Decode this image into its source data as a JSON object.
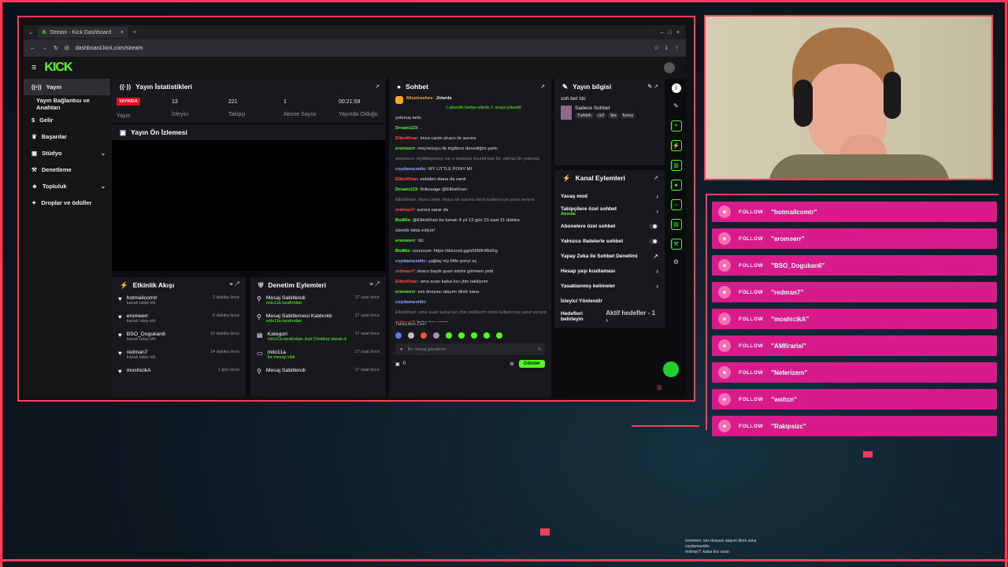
{
  "browser": {
    "tab_title": "Stream - Kick Dashboard",
    "url": "dashboard.kick.com/stream"
  },
  "logo": "KICK",
  "sidebar": {
    "items": [
      {
        "label": "Yayın",
        "icon": "broadcast-icon"
      },
      {
        "label": "Yayın Bağlantısı ve Anahtarı",
        "icon": ""
      },
      {
        "label": "Gelir",
        "icon": "revenue-icon"
      },
      {
        "label": "Başarılar",
        "icon": "trophy-icon"
      },
      {
        "label": "Stüdyo",
        "icon": "studio-icon"
      },
      {
        "label": "Denetleme",
        "icon": "moderation-icon"
      },
      {
        "label": "Topluluk",
        "icon": "community-icon"
      },
      {
        "label": "Droplar ve ödüller",
        "icon": "gift-icon"
      }
    ]
  },
  "stats": {
    "title": "Yayın İstatistikleri",
    "live_badge": "YAYINDA",
    "live_label": "Yayın",
    "viewers_value": "13",
    "viewers_label": "İzleyici",
    "followers_value": "221",
    "followers_label": "Takipçi",
    "subs_value": "1",
    "subs_label": "Abone Sayısı",
    "duration_value": "00:21:59",
    "duration_label": "Yayında Olduğu"
  },
  "preview": {
    "title": "Yayın Ön İzlemesi"
  },
  "activity": {
    "title": "Etkinlik Akışı",
    "items": [
      {
        "name": "hotmailcomtr",
        "sub": "kanalı takip etti",
        "time": "3 dakika önce"
      },
      {
        "name": "eromeerr",
        "sub": "kanalı takip etti",
        "time": "6 dakika önce"
      },
      {
        "name": "BSO_Dogukan6",
        "sub": "kanalı takip etti",
        "time": "10 dakika önce"
      },
      {
        "name": "redman7",
        "sub": "kanalı takip etti",
        "time": "14 dakika önce"
      },
      {
        "name": "moshicikA",
        "sub": "",
        "time": "1 gün önce"
      }
    ]
  },
  "moderation": {
    "title": "Denetim Eylemleri",
    "items": [
      {
        "name": "Mesaj Sabitlendi",
        "sub": "milo11a tarafından",
        "time": "17 saat önce"
      },
      {
        "name": "Mesaj Sabitlemesi Kaldırıldı",
        "sub": "milo11a tarafından",
        "time": "17 saat önce"
      },
      {
        "name": "Kategori",
        "sub": "milo11a tarafından Just Chatting olarak değiştirildi",
        "time": "17 saat önce"
      },
      {
        "name": "milo11a",
        "sub": "bir mesajı sildi",
        "time": "17 saat önce"
      },
      {
        "name": "Mesaj Sabitlendi",
        "sub": "",
        "time": "17 saat önce"
      }
    ]
  },
  "chat": {
    "title": "Sohbet",
    "pinned_user": "Misstrashes",
    "pinned_user2": "Jidanla",
    "pinned_text": "1 abonelik hediye ederek 3. sıraya yükseldi",
    "lines": [
      {
        "user": "",
        "text": "yokmuş tarkı",
        "color": "#ddd"
      },
      {
        "user": "Droam123",
        "text": ": .",
        "color": "#53fc18"
      },
      {
        "user": "ElbisKhan",
        "text": ": imza carim shaco ile aurora",
        "color": "#ff4d4d"
      },
      {
        "user": "eromeerr",
        "text": ": meyvesuyu ile ingilizce denediğim şarkı",
        "color": "#53fc18"
      },
      {
        "user": "",
        "text": "eromeerr: mylittleponey var o messira moziol bak bir varmış bir yokmuş",
        "color": "#888"
      },
      {
        "user": "coydamusidic",
        "text": ": MY LITTLE PONY MI",
        "color": "#8fa7ff"
      },
      {
        "user": "ElbisKhan",
        "text": ": eskiden diana da vardı",
        "color": "#ff4d4d"
      },
      {
        "user": "Droam123",
        "text": ": !followage @ElbisKhan",
        "color": "#53fc18"
      },
      {
        "user": "",
        "text": "ElbisKhan: imza carim shaco ile aurora isimli kullanıcıya yanıt veriyor",
        "color": "#888"
      },
      {
        "user": "redman7",
        "text": ": aurora sarar da",
        "color": "#ff4d4d"
      },
      {
        "user": "BotRix",
        "text": ": @ElbisKhan bu kanalı 4 yıl 13 gün 23 saat 31 dakika",
        "color": "#53fc18"
      },
      {
        "user": "",
        "text": "süredir takip ediyor!",
        "color": "#ddd"
      },
      {
        "user": "eromeerr",
        "text": ": !dc",
        "color": "#53fc18"
      },
      {
        "user": "BotRix",
        "text": ": sunucum: https://discord.gg/s56MK4BdXg",
        "color": "#53fc18"
      },
      {
        "user": "coydamusidic",
        "text": ": çağtay my little ponyi aç",
        "color": "#8fa7ff"
      },
      {
        "user": "redman7",
        "text": ": shaco baydı şuan ismini görmem yetti",
        "color": "#ff4d4d"
      },
      {
        "user": "ElbisKhan",
        "text": ": ama suan kalsa kıcı jhin takiliyom",
        "color": "#ff4d4d"
      },
      {
        "user": "eromeerr",
        "text": ": ses dosyası atayım direk sana",
        "color": "#53fc18"
      },
      {
        "user": "coydamusidic",
        "text": ": ",
        "color": "#8fa7ff"
      },
      {
        "user": "",
        "text": "ElbisKhan: ama suan kalsa kıcı jhin takiliyom isimli kullanıcıya yanıt veriyor",
        "color": "#888"
      },
      {
        "user": "redman7",
        "text": ": kalsa kıcı sarar",
        "color": "#ff4d4d"
      }
    ],
    "followers_only": "Takipçilere Özel",
    "placeholder": "Bir mesaj gönderin",
    "count": "0",
    "send_label": "Gönder"
  },
  "stream_info": {
    "title": "Yayın bilgisi",
    "stream_title": "soh bet !dc",
    "category": "Sadece Sohbet",
    "tags": [
      "Turkish",
      "cs2",
      "fps",
      "funny"
    ]
  },
  "channel_actions": {
    "title": "Kanal Eylemleri",
    "rows": [
      {
        "label": "Yavaş mod",
        "sub": "",
        "right": "›"
      },
      {
        "label": "Takipçilere özel sohbet",
        "sub": "Anında",
        "right": "›"
      },
      {
        "label": "Abonelere özel sohbet",
        "sub": "",
        "right": "toggle"
      },
      {
        "label": "Yalnızca ifadelerle sohbet",
        "sub": "",
        "right": "toggle"
      },
      {
        "label": "Yapay Zeka ile Sohbet Denetimi",
        "sub": "",
        "right": "↗"
      },
      {
        "label": "Hesap yaşı kısıtlaması",
        "sub": "",
        "right": "›"
      },
      {
        "label": "Yasaklanmış kelimeler",
        "sub": "",
        "right": "›"
      },
      {
        "label": "İzleyici Yönlendir",
        "sub": "",
        "right": ""
      },
      {
        "label": "Hedefleri belirleyin",
        "sub": "",
        "right": "Aktif hedefler - 1 ›"
      }
    ]
  },
  "follows": {
    "label": "FOLLOW",
    "names": [
      "\"hotmailcomtr\"",
      "\"eromeerr\"",
      "\"BSO_Dogukan6\"",
      "\"redman7\"",
      "\"moshicikA\"",
      "\"AMfirarisi\"",
      "\"Neferizem\"",
      "\"woltcn\"",
      "\"Rakipsizc\""
    ]
  },
  "mini_chat": [
    "eromeerr: ses dosyası atayım direk sana",
    "coydamusidic: ",
    "redman7: kalsa kıcı sarar"
  ],
  "colors": {
    "accent": "#53fc18",
    "frame": "#ff3b5c",
    "follow_bg": "#d81b8b"
  }
}
